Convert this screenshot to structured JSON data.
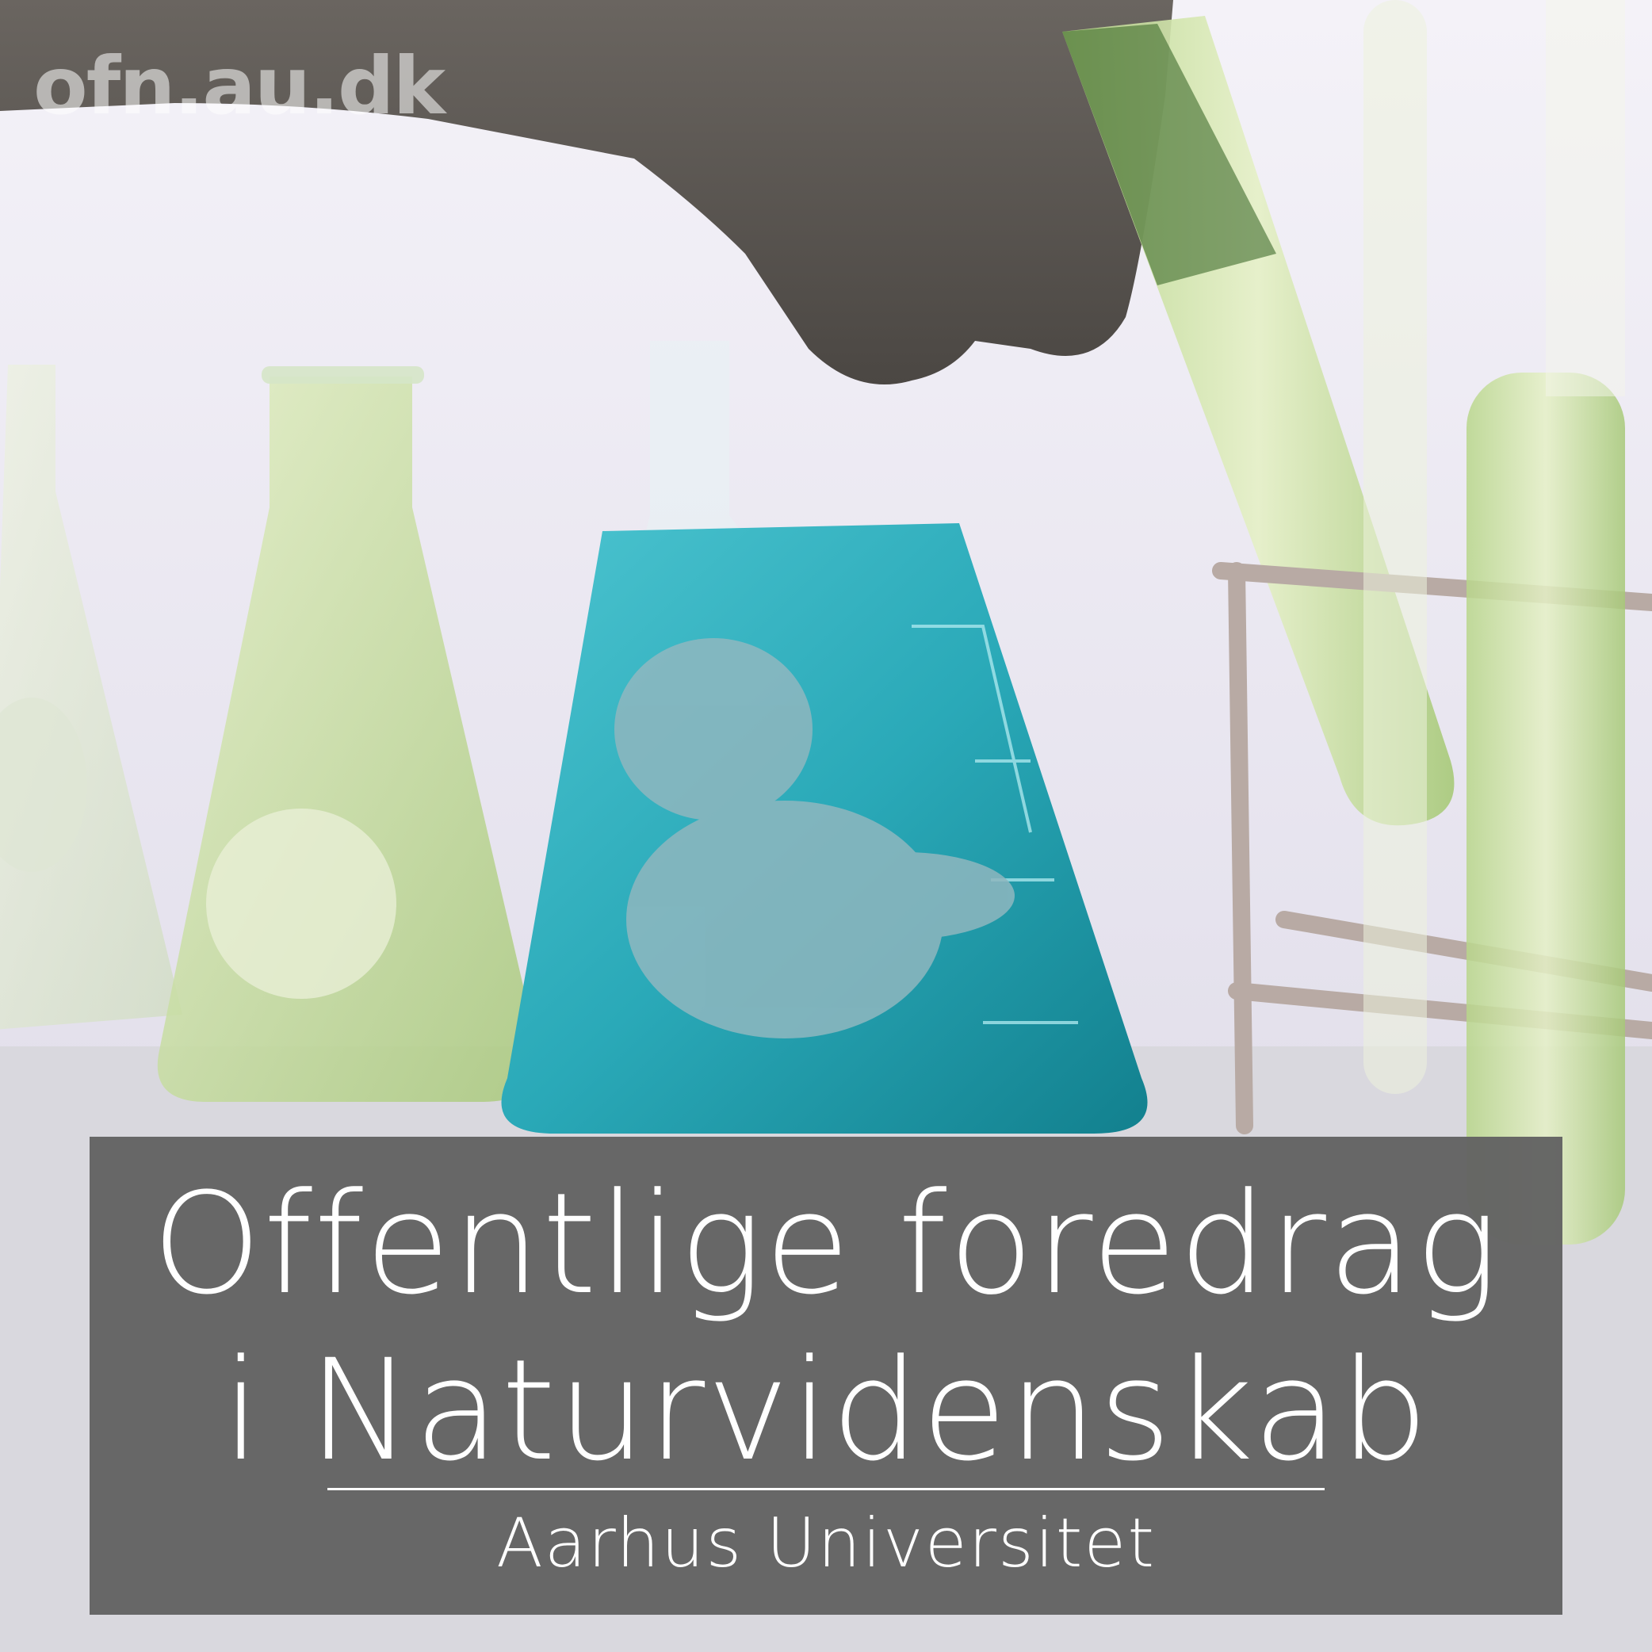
{
  "watermark": "ofn.au.dk",
  "title": {
    "line1": "Offentlige foredrag",
    "line2": "i Naturvidenskab"
  },
  "subtitle": "Aarhus Universitet",
  "colors": {
    "panel": "#626262",
    "text": "#ffffff",
    "background": "#e9e7f0",
    "flask_blue": "#2fb3c1",
    "flask_green": "#c9dca0",
    "glove": "#5e5a55"
  }
}
